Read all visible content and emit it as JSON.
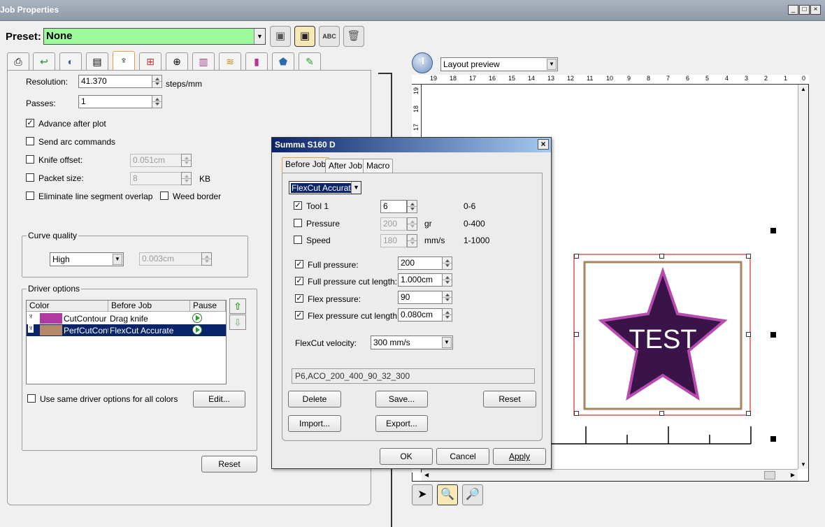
{
  "window": {
    "title": "Job Properties",
    "controls": [
      "_",
      "□",
      "×"
    ]
  },
  "preset": {
    "label": "Preset:",
    "value": "None"
  },
  "toolbar": {
    "icons": [
      "save-icon",
      "save-as-icon",
      "rename-icon",
      "delete-icon"
    ],
    "rename_label": "ABC"
  },
  "tabs": [
    "general",
    "options",
    "color",
    "layout",
    "cut",
    "panel",
    "marks",
    "output",
    "layers",
    "color-adjust",
    "material",
    "edit"
  ],
  "left": {
    "resolution": {
      "label": "Resolution:",
      "value": "41.370",
      "unit": "steps/mm"
    },
    "passes": {
      "label": "Passes:",
      "value": "1"
    },
    "advance_after_plot": {
      "label": "Advance after plot",
      "checked": true
    },
    "send_arc_commands": {
      "label": "Send arc commands",
      "checked": false
    },
    "knife_offset": {
      "label": "Knife offset:",
      "value": "0.051cm",
      "checked": false
    },
    "packet_size": {
      "label": "Packet size:",
      "value": "8",
      "unit": "KB",
      "checked": false
    },
    "eliminate_overlap": {
      "label": "Eliminate line segment overlap",
      "checked": false
    },
    "weed_border": {
      "label": "Weed border",
      "checked": false
    },
    "curve_quality": {
      "title": "Curve quality",
      "value": "High",
      "tolerance": "0.003cm"
    },
    "driver_options": {
      "title": "Driver options",
      "columns": [
        "Color",
        "Before Job",
        "Pause"
      ],
      "rows": [
        {
          "color_name": "CutContour",
          "before_job": "Drag knife",
          "swatch": "#b03aa0",
          "selected": false
        },
        {
          "color_name": "PerfCutContour",
          "before_job": "FlexCut Accurate",
          "swatch": "#b58a6a",
          "selected": true
        }
      ],
      "same_for_all": {
        "label": "Use same driver options for all colors",
        "checked": false
      },
      "edit_label": "Edit..."
    },
    "reset_label": "Reset"
  },
  "preview": {
    "mode": "Layout preview",
    "ruler_top": [
      "19",
      "18",
      "17",
      "16",
      "15",
      "14",
      "13",
      "12",
      "11",
      "10",
      "9",
      "8",
      "7",
      "6",
      "5",
      "4",
      "3",
      "2",
      "1",
      "0"
    ],
    "ruler_left": [
      "19",
      "18",
      "17"
    ],
    "artwork_text": "TEST",
    "colors": {
      "star_fill": "#3a1348",
      "star_outline": "#b84bb0",
      "frame": "#a8855f",
      "selection": "#d83030"
    }
  },
  "dialog": {
    "title": "Summa S160 D",
    "close": "×",
    "tabs": [
      "Before Job",
      "After Job",
      "Macro"
    ],
    "mode": "FlexCut Accurate",
    "tool1": {
      "label": "Tool 1",
      "value": "6",
      "range": "0-6",
      "checked": true
    },
    "pressure": {
      "label": "Pressure",
      "value": "200",
      "unit": "gr",
      "range": "0-400",
      "checked": false
    },
    "speed": {
      "label": "Speed",
      "value": "180",
      "unit": "mm/s",
      "range": "1-1000",
      "checked": false
    },
    "full_pressure": {
      "label": "Full pressure:",
      "value": "200",
      "checked": true
    },
    "full_pressure_cut_length": {
      "label": "Full pressure cut length:",
      "value": "1.000cm",
      "checked": true
    },
    "flex_pressure": {
      "label": "Flex pressure:",
      "value": "90",
      "checked": true
    },
    "flex_pressure_cut_length": {
      "label": "Flex pressure cut length:",
      "value": "0.080cm",
      "checked": true
    },
    "flexcut_velocity": {
      "label": "FlexCut velocity:",
      "value": "300 mm/s"
    },
    "command_string": "P6,ACO_200_400_90_32_300",
    "buttons": {
      "delete": "Delete",
      "save": "Save...",
      "reset": "Reset",
      "import": "Import...",
      "export": "Export...",
      "ok": "OK",
      "cancel": "Cancel",
      "apply": "Apply"
    }
  }
}
